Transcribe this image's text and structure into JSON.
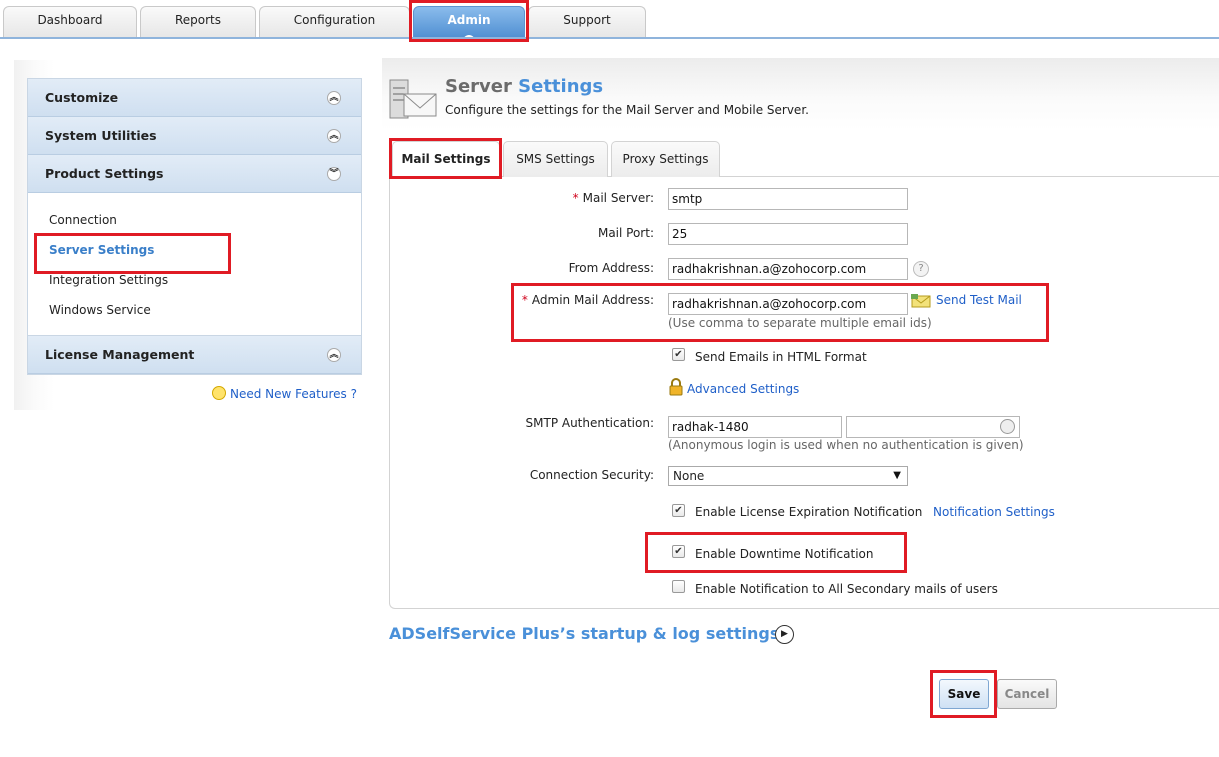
{
  "topnav": {
    "tabs": [
      {
        "label": "Dashboard"
      },
      {
        "label": "Reports"
      },
      {
        "label": "Configuration"
      },
      {
        "label": "Admin",
        "active": true
      },
      {
        "label": "Support"
      }
    ]
  },
  "sidebar": {
    "sections": [
      {
        "label": "Customize"
      },
      {
        "label": "System Utilities"
      },
      {
        "label": "Product Settings"
      },
      {
        "label": "License Management"
      }
    ],
    "product_settings_items": [
      {
        "label": "Connection"
      },
      {
        "label": "Server Settings",
        "selected": true
      },
      {
        "label": "Integration Settings"
      },
      {
        "label": "Windows Service"
      }
    ],
    "need_new_features": "Need New Features ?"
  },
  "page": {
    "title_part1": "Server",
    "title_part2": "Settings",
    "subtitle": "Configure the settings for the Mail Server and Mobile Server."
  },
  "tabs": [
    {
      "label": "Mail Settings",
      "active": true
    },
    {
      "label": "SMS Settings"
    },
    {
      "label": "Proxy Settings"
    }
  ],
  "form": {
    "mail_server_label": "Mail Server:",
    "mail_server_value": "smtp",
    "mail_port_label": "Mail Port:",
    "mail_port_value": "25",
    "from_address_label": "From Address:",
    "from_address_value": "radhakrishnan.a@zohocorp.com",
    "admin_mail_label": "Admin Mail Address:",
    "admin_mail_value": "radhakrishnan.a@zohocorp.com",
    "send_test_mail": "Send Test Mail",
    "admin_mail_hint": "(Use comma to separate multiple email ids)",
    "send_html_label": "Send Emails in HTML Format",
    "advanced_settings": "Advanced Settings",
    "smtp_auth_label": "SMTP Authentication:",
    "smtp_user_value": "radhak-1480",
    "smtp_auth_hint": "(Anonymous login is used when no authentication is given)",
    "connection_security_label": "Connection Security:",
    "connection_security_value": "None",
    "license_expiration_label": "Enable License Expiration Notification",
    "notification_settings": "Notification Settings",
    "downtime_label": "Enable Downtime Notification",
    "secondary_mails_label": "Enable Notification to All Secondary mails of users",
    "required_mark": "*",
    "question_mark": "?"
  },
  "startup_link": "ADSelfService Plus’s startup & log settings",
  "buttons": {
    "save": "Save",
    "cancel": "Cancel"
  }
}
